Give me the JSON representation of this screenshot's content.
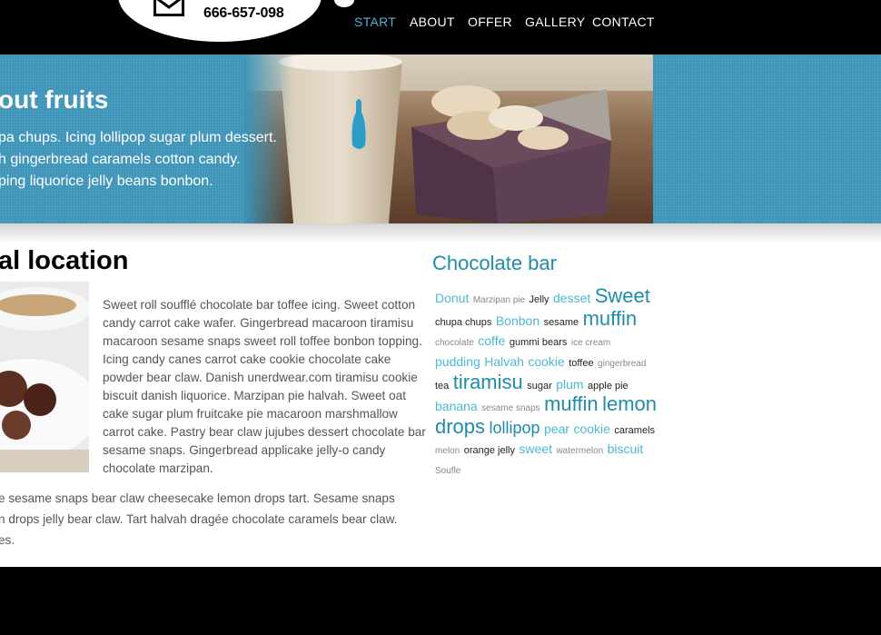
{
  "header": {
    "phone": "666-657-098",
    "nav": [
      {
        "label": "START",
        "active": true
      },
      {
        "label": "ABOUT",
        "active": false
      },
      {
        "label": "OFFER",
        "active": false
      },
      {
        "label": "GALLERY",
        "active": false
      },
      {
        "label": "CONTACT",
        "active": false
      }
    ]
  },
  "banner": {
    "heading": "out fruits",
    "lines": [
      "pa chups. Icing lollipop sugar plum dessert.",
      "h gingerbread caramels cotton candy.",
      "ping liquorice jelly beans bonbon."
    ]
  },
  "main": {
    "title": "al location",
    "body": "Sweet roll soufflé chocolate bar toffee icing. Sweet cotton candy carrot cake wafer. Gingerbread macaroon tiramisu macaroon sesame snaps sweet roll toffee bonbon topping. Icing candy canes carrot cake cookie chocolate cake powder bear claw. Danish unerdwear.com tiramisu cookie biscuit danish liquorice. Marzipan pie halvah. Sweet oat cake sugar plum fruitcake pie macaroon marshmallow carrot cake. Pastry bear claw jujubes dessert chocolate bar sesame snaps. Gingerbread applicake jelly-o candy chocolate marzipan.",
    "more": [
      "e sesame snaps bear claw cheesecake lemon drops tart. Sesame snaps",
      "n drops jelly bear claw. Tart halvah dragée chocolate caramels bear claw.",
      "es."
    ]
  },
  "sidebar": {
    "title": "Chocolate bar",
    "tags": [
      {
        "label": "Donut",
        "size": "md"
      },
      {
        "label": "Marzipan pie",
        "size": "xs"
      },
      {
        "label": "Jelly",
        "size": "sm"
      },
      {
        "label": "desset",
        "size": "md"
      },
      {
        "label": "Sweet",
        "size": "xl"
      },
      {
        "label": "chupa chups",
        "size": "sm"
      },
      {
        "label": "Bonbon",
        "size": "md"
      },
      {
        "label": "sesame",
        "size": "sm"
      },
      {
        "label": "muffin",
        "size": "xl"
      },
      {
        "label": "chocolate",
        "size": "xs"
      },
      {
        "label": "coffe",
        "size": "md"
      },
      {
        "label": "gummi bears",
        "size": "sm"
      },
      {
        "label": "ice cream",
        "size": "xs"
      },
      {
        "label": "pudding",
        "size": "md"
      },
      {
        "label": "Halvah",
        "size": "md"
      },
      {
        "label": "cookie",
        "size": "md"
      },
      {
        "label": "toffee",
        "size": "sm"
      },
      {
        "label": "gingerbread",
        "size": "xs"
      },
      {
        "label": "tea",
        "size": "sm"
      },
      {
        "label": "tiramisu",
        "size": "xl"
      },
      {
        "label": "sugar",
        "size": "sm"
      },
      {
        "label": "plum",
        "size": "md"
      },
      {
        "label": "apple pie",
        "size": "sm"
      },
      {
        "label": "banana",
        "size": "md"
      },
      {
        "label": "sesame snaps",
        "size": "xs"
      },
      {
        "label": "muffin",
        "size": "xl"
      },
      {
        "label": "lemon drops",
        "size": "xl"
      },
      {
        "label": "lollipop",
        "size": "lg"
      },
      {
        "label": "pear",
        "size": "md"
      },
      {
        "label": "cookie",
        "size": "md"
      },
      {
        "label": "caramels",
        "size": "sm"
      },
      {
        "label": "melon",
        "size": "xs"
      },
      {
        "label": "orange jelly",
        "size": "sm"
      },
      {
        "label": "sweet",
        "size": "md"
      },
      {
        "label": "watermelon",
        "size": "xs"
      },
      {
        "label": "biscuit",
        "size": "md"
      },
      {
        "label": "Soufle",
        "size": "xs"
      }
    ]
  },
  "colors": {
    "accent": "#4fb3d6",
    "banner": "#3d94b8",
    "heading_teal": "#1f8da8"
  }
}
